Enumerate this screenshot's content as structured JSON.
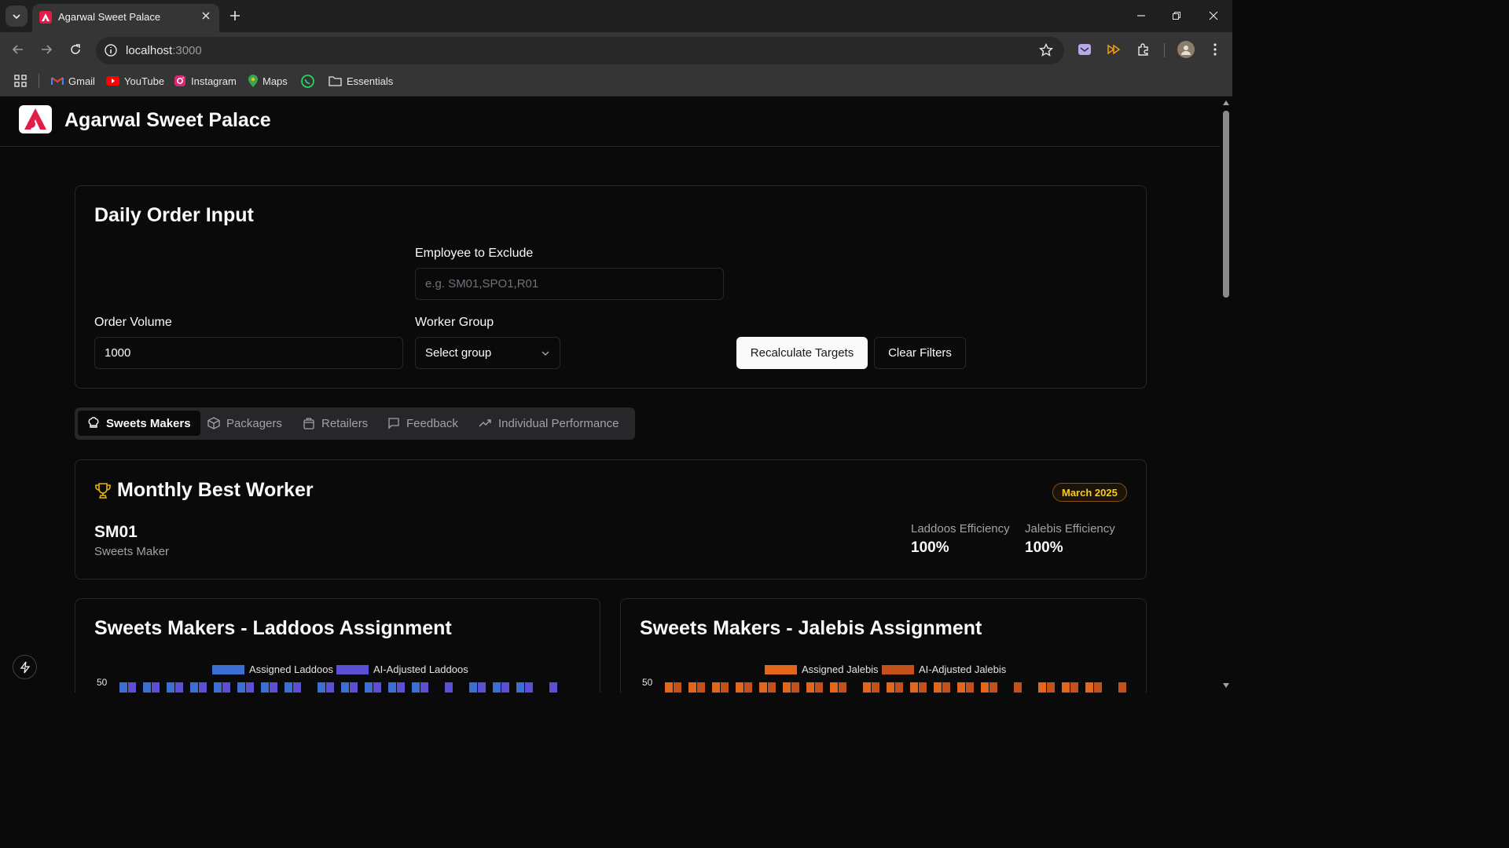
{
  "browser": {
    "tab_title": "Agarwal Sweet Palace",
    "url_host": "localhost",
    "url_port": ":3000",
    "bookmarks": [
      {
        "label": "Gmail",
        "icon": "gmail-icon"
      },
      {
        "label": "YouTube",
        "icon": "youtube-icon"
      },
      {
        "label": "Instagram",
        "icon": "instagram-icon"
      },
      {
        "label": "Maps",
        "icon": "maps-icon"
      },
      {
        "label": "",
        "icon": "whatsapp-icon"
      },
      {
        "label": "Essentials",
        "icon": "folder-icon"
      }
    ]
  },
  "app": {
    "title": "Agarwal Sweet Palace",
    "brand_color": "#e11d48"
  },
  "order_input": {
    "title": "Daily Order Input",
    "exclude_label": "Employee to Exclude",
    "exclude_placeholder": "e.g. SM01,SPO1,R01",
    "volume_label": "Order Volume",
    "volume_value": "1000",
    "group_label": "Worker Group",
    "group_value": "Select group",
    "recalc_label": "Recalculate Targets",
    "clear_label": "Clear Filters"
  },
  "tabs": [
    {
      "label": "Sweets Makers",
      "icon": "chef-hat-icon",
      "active": true
    },
    {
      "label": "Packagers",
      "icon": "package-icon",
      "active": false
    },
    {
      "label": "Retailers",
      "icon": "shopping-bag-icon",
      "active": false
    },
    {
      "label": "Feedback",
      "icon": "message-square-icon",
      "active": false
    },
    {
      "label": "Individual Performance",
      "icon": "trending-up-icon",
      "active": false
    }
  ],
  "best_worker": {
    "title": "Monthly Best Worker",
    "month": "March 2025",
    "id": "SM01",
    "role": "Sweets Maker",
    "stats": [
      {
        "label": "Laddoos Efficiency",
        "value": "100%"
      },
      {
        "label": "Jalebis Efficiency",
        "value": "100%"
      }
    ]
  },
  "chart_data": [
    {
      "type": "bar",
      "title": "Sweets Makers - Laddoos Assignment",
      "series": [
        {
          "name": "Assigned Laddoos",
          "color": "#3b6fd4"
        },
        {
          "name": "AI-Adjusted Laddoos",
          "color": "#5b4fd6"
        }
      ],
      "y_ticks": [
        "50"
      ]
    },
    {
      "type": "bar",
      "title": "Sweets Makers - Jalebis Assignment",
      "series": [
        {
          "name": "Assigned Jalebis",
          "color": "#e2671a"
        },
        {
          "name": "AI-Adjusted Jalebis",
          "color": "#c4501a"
        }
      ],
      "y_ticks": [
        "50"
      ]
    }
  ]
}
